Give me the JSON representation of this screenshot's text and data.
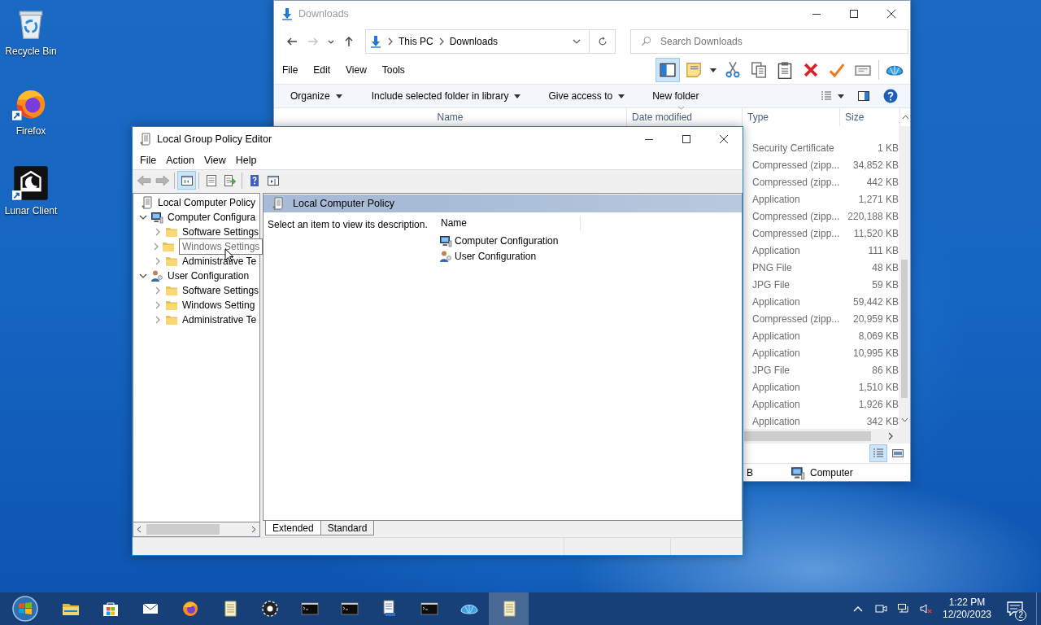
{
  "desktop_icons": [
    {
      "label": "Recycle Bin",
      "kind": "recycle",
      "shortcut": false
    },
    {
      "label": "Firefox",
      "kind": "firefox",
      "shortcut": true
    },
    {
      "label": "Lunar Client",
      "kind": "lunar",
      "shortcut": true
    }
  ],
  "explorer": {
    "title": "Downloads",
    "nav": [
      {
        "kind": "back",
        "disabled": false
      },
      {
        "kind": "forward",
        "disabled": true
      },
      {
        "kind": "recent",
        "disabled": false
      },
      {
        "kind": "up",
        "disabled": false
      }
    ],
    "breadcrumb": [
      "This PC",
      "Downloads"
    ],
    "search": {
      "placeholder": "Search Downloads"
    },
    "menu": [
      "File",
      "Edit",
      "View",
      "Tools"
    ],
    "navigation_pane_on": true,
    "toolbar": [
      {
        "kind": "navpane"
      },
      {
        "kind": "properties"
      },
      {
        "kind": "cut"
      },
      {
        "kind": "copy"
      },
      {
        "kind": "paste"
      },
      {
        "kind": "delete"
      },
      {
        "kind": "check"
      },
      {
        "kind": "card"
      },
      {
        "kind": "shell"
      }
    ],
    "commands": [
      {
        "label": "Organize",
        "dropdown": true
      },
      {
        "label": "Include selected folder in library",
        "dropdown": true
      },
      {
        "label": "Give access to",
        "dropdown": true
      },
      {
        "label": "New folder",
        "dropdown": false
      }
    ],
    "columns": [
      "Name",
      "Date modified",
      "Type",
      "Size"
    ],
    "rows": [
      {
        "type": "Security Certificate",
        "size": "1 KB"
      },
      {
        "type": "Compressed (zipp...",
        "size": "34,852 KB"
      },
      {
        "type": "Compressed (zipp...",
        "size": "442 KB"
      },
      {
        "type": "Application",
        "size": "1,271 KB"
      },
      {
        "type": "Compressed (zipp...",
        "size": "220,188 KB"
      },
      {
        "type": "Compressed (zipp...",
        "size": "11,520 KB"
      },
      {
        "type": "Application",
        "size": "111 KB"
      },
      {
        "type": "PNG File",
        "size": "48 KB"
      },
      {
        "type": "JPG File",
        "size": "59 KB"
      },
      {
        "type": "Application",
        "size": "59,442 KB"
      },
      {
        "type": "Compressed (zipp...",
        "size": "20,959 KB"
      },
      {
        "type": "Application",
        "size": "8,069 KB"
      },
      {
        "type": "Application",
        "size": "10,995 KB"
      },
      {
        "type": "JPG File",
        "size": "86 KB"
      },
      {
        "type": "Application",
        "size": "1,510 KB"
      },
      {
        "type": "Application",
        "size": "1,926 KB"
      },
      {
        "type": "Application",
        "size": "342 KB"
      }
    ],
    "views": [
      {
        "kind": "details",
        "selected": true
      },
      {
        "kind": "large",
        "selected": false
      }
    ],
    "status_size": "B",
    "status_location": "Computer"
  },
  "policy_editor": {
    "title": "Local Group Policy Editor",
    "menu": [
      "File",
      "Action",
      "View",
      "Help"
    ],
    "toolbar_groups": [
      [
        {
          "kind": "back",
          "selected": false,
          "disabled": true
        },
        {
          "kind": "forward",
          "selected": false,
          "disabled": true
        }
      ],
      [
        {
          "kind": "tree",
          "selected": true,
          "disabled": false
        }
      ],
      [
        {
          "kind": "list",
          "selected": false,
          "disabled": false
        },
        {
          "kind": "export",
          "selected": false,
          "disabled": false
        }
      ],
      [
        {
          "kind": "help",
          "selected": false,
          "disabled": false
        },
        {
          "kind": "actionpane",
          "selected": false,
          "disabled": false
        }
      ]
    ],
    "tree": [
      {
        "label": "Local Computer Policy",
        "kind": "policy",
        "hovered": false,
        "children": [
          {
            "label": "Computer Configura",
            "kind": "computer",
            "expanded": true,
            "hovered": false,
            "children": [
              {
                "label": "Software Settings",
                "kind": "folder",
                "expanded": false,
                "hovered": false
              },
              {
                "label": "Windows Settings",
                "kind": "folder",
                "expanded": false,
                "hovered": true
              },
              {
                "label": "Administrative Te",
                "kind": "folder",
                "expanded": false,
                "hovered": false
              }
            ]
          },
          {
            "label": "User Configuration",
            "kind": "user",
            "expanded": true,
            "hovered": false,
            "children": [
              {
                "label": "Software Settings",
                "kind": "folder",
                "expanded": false,
                "hovered": false
              },
              {
                "label": "Windows Setting",
                "kind": "folder",
                "expanded": false,
                "hovered": false
              },
              {
                "label": "Administrative Te",
                "kind": "folder",
                "expanded": false,
                "hovered": false
              }
            ]
          }
        ]
      }
    ],
    "pane_title": "Local Computer Policy",
    "description": "Select an item to view its description.",
    "list_column": "Name",
    "items": [
      {
        "label": "Computer Configuration",
        "kind": "computer"
      },
      {
        "label": "User Configuration",
        "kind": "user"
      }
    ],
    "tabs": [
      {
        "label": "Extended",
        "selected": true
      },
      {
        "label": "Standard",
        "selected": false
      }
    ]
  },
  "taskbar": {
    "apps": [
      {
        "kind": "explorer",
        "selected": false
      },
      {
        "kind": "store",
        "selected": false
      },
      {
        "kind": "mail",
        "selected": false
      },
      {
        "kind": "firefox",
        "selected": false
      },
      {
        "kind": "notepad",
        "selected": false
      },
      {
        "kind": "gear",
        "selected": false
      },
      {
        "kind": "terminal",
        "selected": false
      },
      {
        "kind": "terminal",
        "selected": false
      },
      {
        "kind": "policy",
        "selected": false
      },
      {
        "kind": "terminal",
        "selected": false
      },
      {
        "kind": "shell",
        "selected": false
      },
      {
        "kind": "notepad",
        "selected": true
      }
    ],
    "time": "1:22 PM",
    "date": "12/20/2023",
    "notifications": "2"
  }
}
